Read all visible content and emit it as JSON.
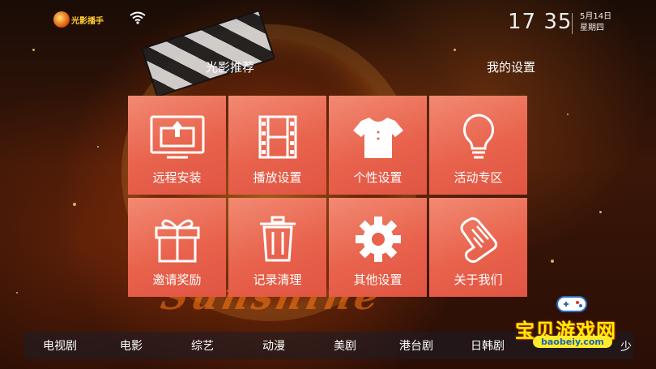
{
  "header": {
    "logo_text": "光影播手",
    "clock": "17 35",
    "date_line1": "5月14日",
    "date_line2": "星期四"
  },
  "tabs": [
    "光影推荐",
    "我的设置"
  ],
  "tiles": [
    {
      "label": "远程安装",
      "icon": "remote-install-icon"
    },
    {
      "label": "播放设置",
      "icon": "film-icon"
    },
    {
      "label": "个性设置",
      "icon": "tshirt-icon"
    },
    {
      "label": "活动专区",
      "icon": "lightbulb-icon"
    },
    {
      "label": "邀请奖励",
      "icon": "gift-icon"
    },
    {
      "label": "记录清理",
      "icon": "trash-icon"
    },
    {
      "label": "其他设置",
      "icon": "gear-icon"
    },
    {
      "label": "关于我们",
      "icon": "scroll-icon"
    }
  ],
  "bottom_nav": [
    "电视剧",
    "电影",
    "综艺",
    "动漫",
    "美剧",
    "港台剧",
    "日韩剧"
  ],
  "bottom_nav_edge": "少",
  "watermark": {
    "title": "宝贝游戏网",
    "url": "baobeiy.com"
  },
  "colors": {
    "tile": "#e8624c",
    "accent": "#ffcc33"
  }
}
